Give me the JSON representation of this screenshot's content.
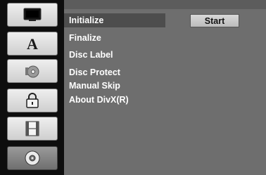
{
  "menu": {
    "items": [
      {
        "label": "Initialize"
      },
      {
        "label": "Finalize"
      },
      {
        "label": "Disc Label"
      },
      {
        "label": "Disc Protect"
      },
      {
        "label": "Manual Skip"
      },
      {
        "label": "About DivX(R)"
      }
    ],
    "selected_index": 0
  },
  "action": {
    "start_label": "Start"
  },
  "sidebar": {
    "icons": [
      "tv-icon",
      "font-icon",
      "disc-audio-icon",
      "lock-icon",
      "film-icon",
      "disc-icon"
    ],
    "active_index": 5
  }
}
